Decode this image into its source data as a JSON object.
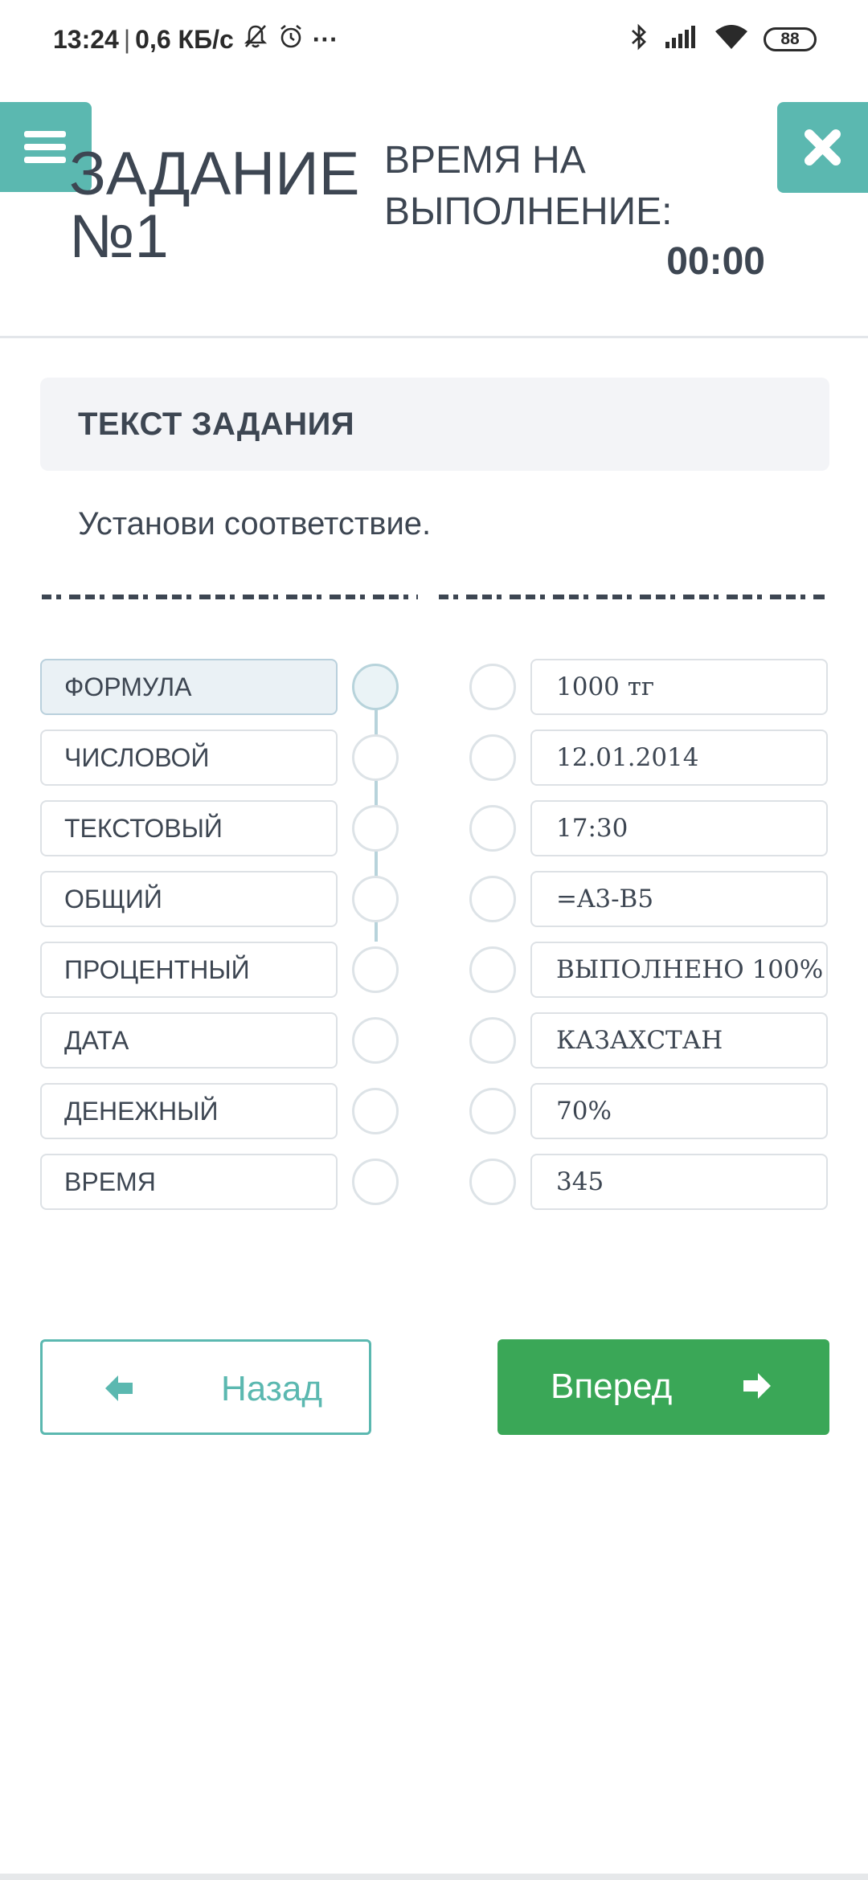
{
  "status_bar": {
    "time": "13:24",
    "separator": "|",
    "speed": "0,6 КБ/с",
    "more": "···",
    "battery": "88"
  },
  "header": {
    "task_title": "ЗАДАНИЕ №1",
    "time_label": "ВРЕМЯ НА ВЫПОЛНЕНИЕ:",
    "time_value": "00:00",
    "menu_icon": "hamburger-menu-icon",
    "close_icon": "close-x-icon"
  },
  "task": {
    "heading": "ТЕКСТ ЗАДАНИЯ",
    "instruction": "Установи соответствие."
  },
  "matching": {
    "left_items": [
      {
        "label": "ФОРМУЛА",
        "selected": true
      },
      {
        "label": "ЧИСЛОВОЙ",
        "selected": false
      },
      {
        "label": "ТЕКСТОВЫЙ",
        "selected": false
      },
      {
        "label": "ОБЩИЙ",
        "selected": false
      },
      {
        "label": "ПРОЦЕНТНЫЙ",
        "selected": false
      },
      {
        "label": "ДАТА",
        "selected": false
      },
      {
        "label": "ДЕНЕЖНЫЙ",
        "selected": false
      },
      {
        "label": "ВРЕМЯ",
        "selected": false
      }
    ],
    "right_items": [
      {
        "label": "1000 тг"
      },
      {
        "label": "12.01.2014"
      },
      {
        "label": "17:30"
      },
      {
        "label": "=A3-B5"
      },
      {
        "label": "ВЫПОЛНЕНО 100%"
      },
      {
        "label": "КАЗАХСТАН"
      },
      {
        "label": "70%"
      },
      {
        "label": "345"
      }
    ]
  },
  "navigation": {
    "back_label": "Назад",
    "next_label": "Вперед",
    "back_icon": "arrow-left-icon",
    "next_icon": "arrow-right-icon"
  },
  "colors": {
    "accent_teal": "#5bb8b0",
    "next_green": "#3aa757",
    "text_dark": "#3d4652",
    "selected_bg": "#eaf1f5"
  }
}
